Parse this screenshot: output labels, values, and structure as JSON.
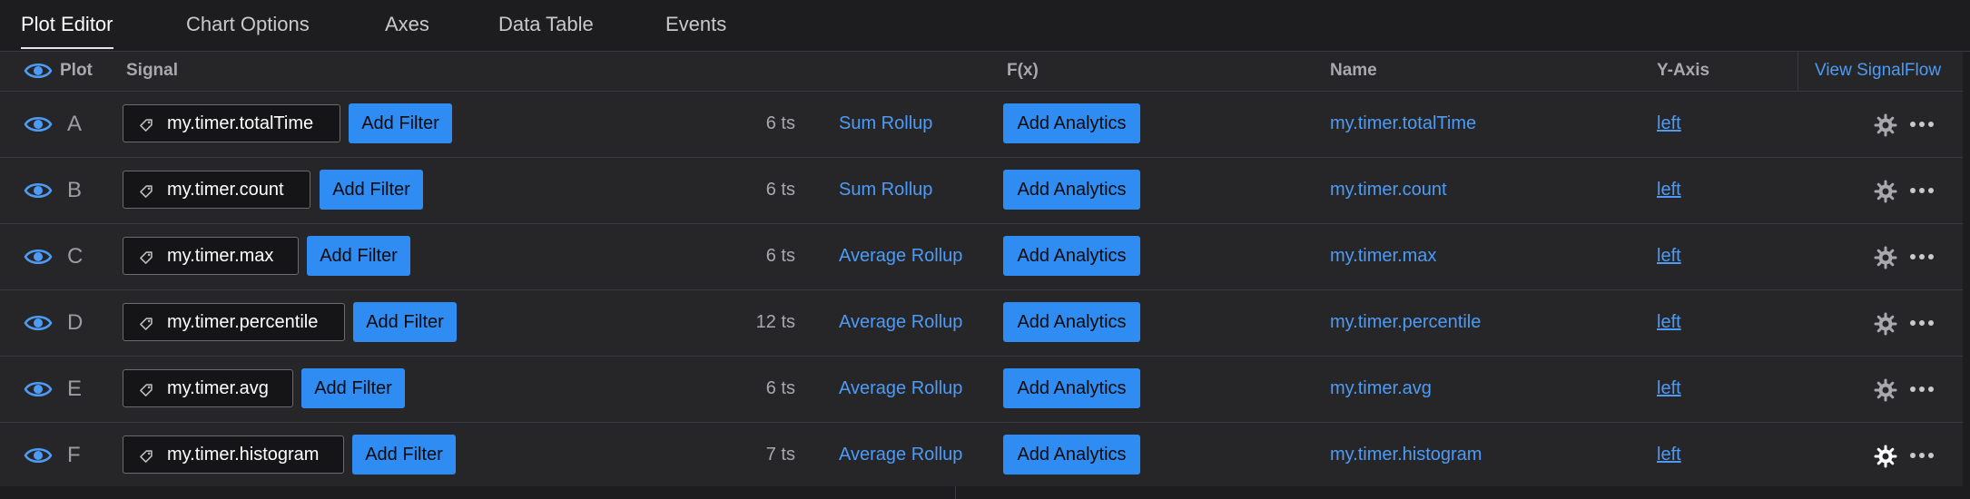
{
  "tabs": [
    {
      "label": "Plot Editor",
      "active": true
    },
    {
      "label": "Chart Options",
      "active": false
    },
    {
      "label": "Axes",
      "active": false
    },
    {
      "label": "Data Table",
      "active": false
    },
    {
      "label": "Events",
      "active": false
    }
  ],
  "header": {
    "plot": "Plot",
    "signal": "Signal",
    "fx": "F(x)",
    "name": "Name",
    "yaxis": "Y-Axis",
    "view_signalflow": "View SignalFlow"
  },
  "colors": {
    "accent": "#2f8cf2",
    "link": "#4d9bf5",
    "background": "#1d1d1f",
    "row_background": "#262629"
  },
  "rows": [
    {
      "letter": "A",
      "signal": "my.timer.totalTime",
      "add_filter": "Add Filter",
      "ts": "6 ts",
      "rollup": "Sum Rollup",
      "add_analytics": "Add Analytics",
      "name": "my.timer.totalTime",
      "yaxis": "left",
      "visible": true
    },
    {
      "letter": "B",
      "signal": "my.timer.count",
      "add_filter": "Add Filter",
      "ts": "6 ts",
      "rollup": "Sum Rollup",
      "add_analytics": "Add Analytics",
      "name": "my.timer.count",
      "yaxis": "left",
      "visible": true
    },
    {
      "letter": "C",
      "signal": "my.timer.max",
      "add_filter": "Add Filter",
      "ts": "6 ts",
      "rollup": "Average Rollup",
      "add_analytics": "Add Analytics",
      "name": "my.timer.max",
      "yaxis": "left",
      "visible": true
    },
    {
      "letter": "D",
      "signal": "my.timer.percentile",
      "add_filter": "Add Filter",
      "ts": "12 ts",
      "rollup": "Average Rollup",
      "add_analytics": "Add Analytics",
      "name": "my.timer.percentile",
      "yaxis": "left",
      "visible": true
    },
    {
      "letter": "E",
      "signal": "my.timer.avg",
      "add_filter": "Add Filter",
      "ts": "6 ts",
      "rollup": "Average Rollup",
      "add_analytics": "Add Analytics",
      "name": "my.timer.avg",
      "yaxis": "left",
      "visible": true
    },
    {
      "letter": "F",
      "signal": "my.timer.histogram",
      "add_filter": "Add Filter",
      "ts": "7 ts",
      "rollup": "Average Rollup",
      "add_analytics": "Add Analytics",
      "name": "my.timer.histogram",
      "yaxis": "left",
      "visible": true
    }
  ],
  "icons": {
    "visibility": "eye-icon",
    "signal": "tag-icon",
    "settings": "gear-icon",
    "more": "more-horizontal-icon"
  }
}
